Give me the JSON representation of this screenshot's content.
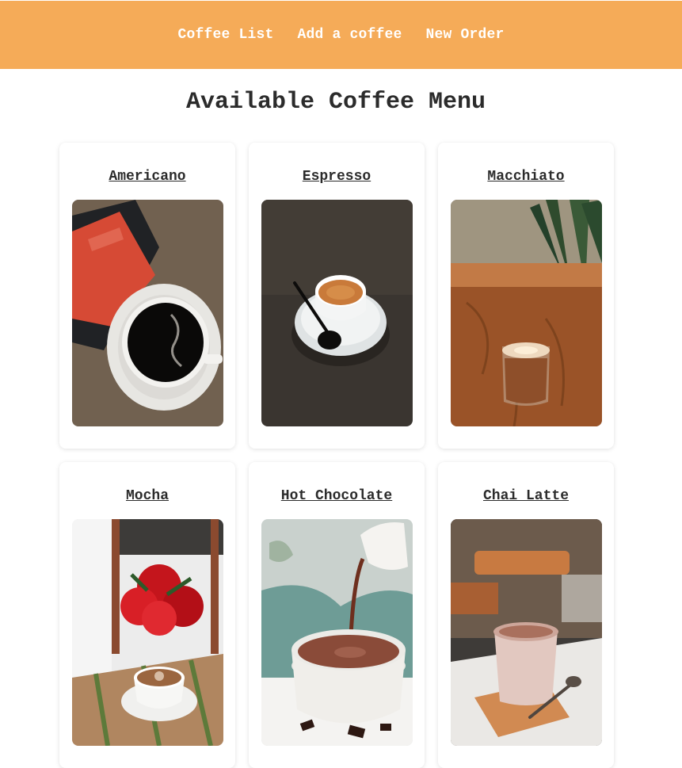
{
  "nav": {
    "items": [
      {
        "label": "Coffee List"
      },
      {
        "label": "Add a coffee"
      },
      {
        "label": "New Order"
      }
    ]
  },
  "page": {
    "title": "Available Coffee Menu"
  },
  "coffees": [
    {
      "name": "Americano"
    },
    {
      "name": "Espresso"
    },
    {
      "name": "Macchiato"
    },
    {
      "name": "Mocha"
    },
    {
      "name": "Hot Chocolate"
    },
    {
      "name": "Chai Latte"
    }
  ],
  "colors": {
    "header": "#f5ab58",
    "nav_text": "#ffffff",
    "text": "#2b2b2b"
  }
}
